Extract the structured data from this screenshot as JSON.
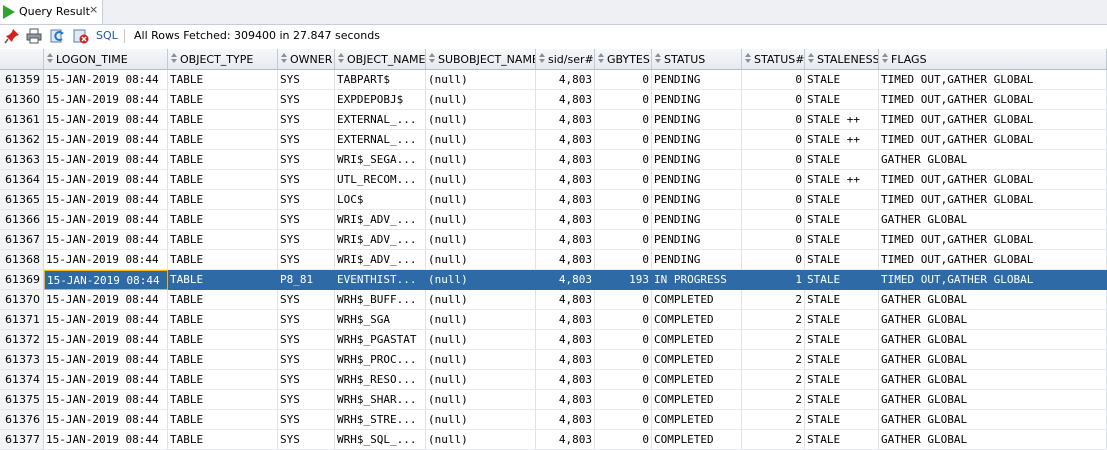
{
  "tab": {
    "title": "Query Result",
    "close": "×"
  },
  "toolbar": {
    "sql_label": "SQL",
    "status": "All Rows Fetched: 309400 in 27.847 seconds"
  },
  "columns": [
    "LOGON_TIME",
    "OBJECT_TYPE",
    "OWNER",
    "OBJECT_NAME",
    "SUBOBJECT_NAME",
    "sid/ser#",
    "GBYTES",
    "STATUS",
    "STATUS#",
    "STALENESS",
    "FLAGS"
  ],
  "rows": [
    {
      "n": "61359",
      "c": [
        "15-JAN-2019 08:44",
        "TABLE",
        "SYS",
        "TABPART$",
        "(null)",
        "4,803",
        "0",
        "PENDING",
        "0",
        "STALE",
        "TIMED OUT,GATHER GLOBAL"
      ]
    },
    {
      "n": "61360",
      "c": [
        "15-JAN-2019 08:44",
        "TABLE",
        "SYS",
        "EXPDEPOBJ$",
        "(null)",
        "4,803",
        "0",
        "PENDING",
        "0",
        "STALE",
        "TIMED OUT,GATHER GLOBAL"
      ]
    },
    {
      "n": "61361",
      "c": [
        "15-JAN-2019 08:44",
        "TABLE",
        "SYS",
        "EXTERNAL_...",
        "(null)",
        "4,803",
        "0",
        "PENDING",
        "0",
        "STALE ++",
        "TIMED OUT,GATHER GLOBAL"
      ]
    },
    {
      "n": "61362",
      "c": [
        "15-JAN-2019 08:44",
        "TABLE",
        "SYS",
        "EXTERNAL_...",
        "(null)",
        "4,803",
        "0",
        "PENDING",
        "0",
        "STALE ++",
        "TIMED OUT,GATHER GLOBAL"
      ]
    },
    {
      "n": "61363",
      "c": [
        "15-JAN-2019 08:44",
        "TABLE",
        "SYS",
        "WRI$_SEGA...",
        "(null)",
        "4,803",
        "0",
        "PENDING",
        "0",
        "STALE",
        "GATHER GLOBAL"
      ]
    },
    {
      "n": "61364",
      "c": [
        "15-JAN-2019 08:44",
        "TABLE",
        "SYS",
        "UTL_RECOM...",
        "(null)",
        "4,803",
        "0",
        "PENDING",
        "0",
        "STALE ++",
        "TIMED OUT,GATHER GLOBAL"
      ]
    },
    {
      "n": "61365",
      "c": [
        "15-JAN-2019 08:44",
        "TABLE",
        "SYS",
        "LOC$",
        "(null)",
        "4,803",
        "0",
        "PENDING",
        "0",
        "STALE",
        "TIMED OUT,GATHER GLOBAL"
      ]
    },
    {
      "n": "61366",
      "c": [
        "15-JAN-2019 08:44",
        "TABLE",
        "SYS",
        "WRI$_ADV_...",
        "(null)",
        "4,803",
        "0",
        "PENDING",
        "0",
        "STALE",
        "GATHER GLOBAL"
      ]
    },
    {
      "n": "61367",
      "c": [
        "15-JAN-2019 08:44",
        "TABLE",
        "SYS",
        "WRI$_ADV_...",
        "(null)",
        "4,803",
        "0",
        "PENDING",
        "0",
        "STALE",
        "TIMED OUT,GATHER GLOBAL"
      ]
    },
    {
      "n": "61368",
      "c": [
        "15-JAN-2019 08:44",
        "TABLE",
        "SYS",
        "WRI$_ADV_...",
        "(null)",
        "4,803",
        "0",
        "PENDING",
        "0",
        "STALE",
        "TIMED OUT,GATHER GLOBAL"
      ]
    },
    {
      "n": "61369",
      "sel": true,
      "c": [
        "15-JAN-2019 08:44",
        "TABLE",
        "P8_81",
        "EVENTHIST...",
        "(null)",
        "4,803",
        "193",
        "IN PROGRESS",
        "1",
        "STALE",
        "TIMED OUT,GATHER GLOBAL"
      ]
    },
    {
      "n": "61370",
      "c": [
        "15-JAN-2019 08:44",
        "TABLE",
        "SYS",
        "WRH$_BUFF...",
        "(null)",
        "4,803",
        "0",
        "COMPLETED",
        "2",
        "STALE",
        "GATHER GLOBAL"
      ]
    },
    {
      "n": "61371",
      "c": [
        "15-JAN-2019 08:44",
        "TABLE",
        "SYS",
        "WRH$_SGA",
        "(null)",
        "4,803",
        "0",
        "COMPLETED",
        "2",
        "STALE",
        "GATHER GLOBAL"
      ]
    },
    {
      "n": "61372",
      "c": [
        "15-JAN-2019 08:44",
        "TABLE",
        "SYS",
        "WRH$_PGASTAT",
        "(null)",
        "4,803",
        "0",
        "COMPLETED",
        "2",
        "STALE",
        "GATHER GLOBAL"
      ]
    },
    {
      "n": "61373",
      "c": [
        "15-JAN-2019 08:44",
        "TABLE",
        "SYS",
        "WRH$_PROC...",
        "(null)",
        "4,803",
        "0",
        "COMPLETED",
        "2",
        "STALE",
        "GATHER GLOBAL"
      ]
    },
    {
      "n": "61374",
      "c": [
        "15-JAN-2019 08:44",
        "TABLE",
        "SYS",
        "WRH$_RESO...",
        "(null)",
        "4,803",
        "0",
        "COMPLETED",
        "2",
        "STALE",
        "GATHER GLOBAL"
      ]
    },
    {
      "n": "61375",
      "c": [
        "15-JAN-2019 08:44",
        "TABLE",
        "SYS",
        "WRH$_SHAR...",
        "(null)",
        "4,803",
        "0",
        "COMPLETED",
        "2",
        "STALE",
        "GATHER GLOBAL"
      ]
    },
    {
      "n": "61376",
      "c": [
        "15-JAN-2019 08:44",
        "TABLE",
        "SYS",
        "WRH$_STRE...",
        "(null)",
        "4,803",
        "0",
        "COMPLETED",
        "2",
        "STALE",
        "GATHER GLOBAL"
      ]
    },
    {
      "n": "61377",
      "c": [
        "15-JAN-2019 08:44",
        "TABLE",
        "SYS",
        "WRH$_SQL_...",
        "(null)",
        "4,803",
        "0",
        "COMPLETED",
        "2",
        "STALE",
        "GATHER GLOBAL"
      ]
    }
  ],
  "colors": {
    "selection": "#2d6aa6",
    "run_green": "#2fa52f",
    "sql_blue": "#1d56b5"
  },
  "icons": [
    "pin-icon",
    "print-icon",
    "refresh-icon",
    "cancel-icon",
    "run-icon"
  ]
}
